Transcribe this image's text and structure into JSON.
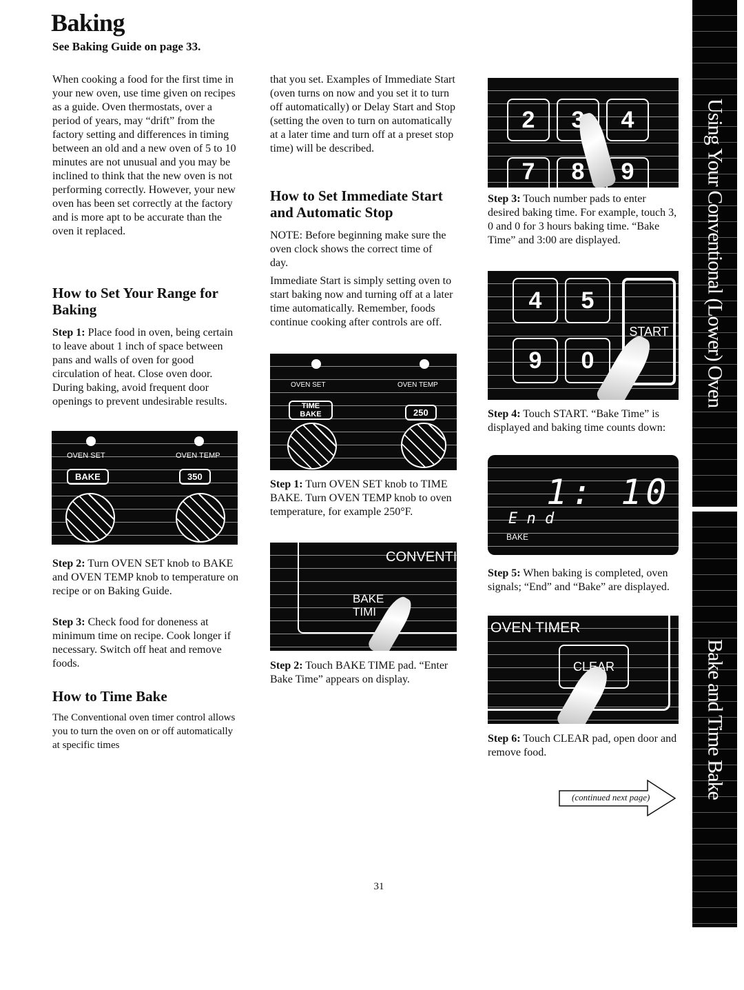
{
  "title": "Baking",
  "subtitle": "See Baking Guide on page 33.",
  "intro": "When cooking a food for the first time in your new oven, use time given on recipes as a guide. Oven thermostats, over a period of years, may “drift” from the factory setting and differences in timing between an old and a new oven of 5 to 10 minutes are not unusual and you may be inclined to think that the new oven is not performing correctly. However, your new oven has been set correctly at the factory and is more apt to be accurate than the oven it replaced.",
  "range": {
    "heading": "How to Set Your Range for Baking",
    "step1_label": "Step 1:",
    "step1": " Place food in oven, being certain to leave about 1 inch of space between pans and walls of oven for good circulation of heat. Close oven door. During baking, avoid frequent door openings to prevent undesirable results.",
    "image": {
      "oven_set": "OVEN SET",
      "oven_temp": "OVEN TEMP",
      "setting": "BAKE",
      "temp": "350"
    },
    "step2_label": "Step 2:",
    "step2": " Turn OVEN SET knob to BAKE and OVEN TEMP knob to temperature on recipe or on Baking Guide.",
    "step3_label": "Step 3:",
    "step3": " Check food for doneness at minimum time on recipe. Cook longer if necessary. Switch off heat and remove foods."
  },
  "timebake": {
    "heading": "How to Time Bake",
    "text": "The Conventional oven timer control allows you to turn the oven on or off automatically at specific times",
    "text2": "that you set. Examples of Immediate Start (oven turns on now and you set it to turn off automatically) or Delay Start and Stop (setting the oven to turn on automatically at a later time and turn off at a preset stop time) will be described."
  },
  "immediate": {
    "heading": "How to Set Immediate Start and Automatic Stop",
    "note": "NOTE: Before beginning make sure the oven clock shows the correct time of day.",
    "text": "Immediate Start is simply setting oven to start baking now and turning off at a later time automatically. Remember, foods continue cooking after controls are off.",
    "image1": {
      "oven_set": "OVEN SET",
      "oven_temp": "OVEN TEMP",
      "setting_line1": "TIME",
      "setting_line2": "BAKE",
      "temp": "250"
    },
    "step1_label": "Step 1:",
    "step1": " Turn OVEN SET knob to TIME BAKE. Turn OVEN TEMP knob to oven temperature, for example 250°F.",
    "image2": {
      "panel": "CONVENTI",
      "pad_line1": "BAKE",
      "pad_line2": "TIMI"
    },
    "step2_label": "Step 2:",
    "step2": " Touch BAKE TIME pad. “Enter Bake Time” appears on display."
  },
  "col3": {
    "keypad1": [
      "2",
      "3",
      "4",
      "7",
      "8",
      "9"
    ],
    "step3_label": "Step 3:",
    "step3": " Touch number pads to enter desired baking time. For example, touch 3, 0 and 0 for 3 hours baking time. “Bake Time” and 3:00 are displayed.",
    "keypad2": [
      "4",
      "5",
      "9",
      "0"
    ],
    "start": "START",
    "step4_label": "Step 4:",
    "step4": " Touch START. “Bake Time” is displayed and baking time counts down:",
    "display": {
      "time": "1: 10",
      "end": "E n d",
      "bake": "BAKE"
    },
    "step5_label": "Step 5:",
    "step5": " When baking is completed, oven signals; “End” and “Bake” are displayed.",
    "timer": {
      "label": "OVEN TIMER",
      "clear": "CLEAR"
    },
    "step6_label": "Step 6:",
    "step6": " Touch CLEAR pad, open door and remove food.",
    "continued": "(continued next page)"
  },
  "sidebar": {
    "section": "Using Your Conventional (Lower) Oven",
    "topic": "Bake and Time Bake"
  },
  "page_number": "31"
}
